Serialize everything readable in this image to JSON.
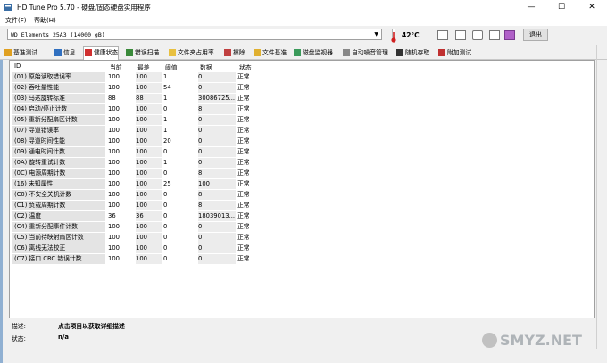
{
  "window": {
    "title": "HD Tune Pro 5.70 - 硬盘/固态硬盘实用程序",
    "minimize": "—",
    "maximize": "☐",
    "close": "✕"
  },
  "menu": [
    "文件(F)",
    "帮助(H)"
  ],
  "drive": {
    "selected": "WD      Elements 25A3 (14000 gB)",
    "temperature": "42°C",
    "exit_label": "退出"
  },
  "toolbar_icons": [
    "copy-icon",
    "copy-all-icon",
    "screenshot-icon",
    "options-icon",
    "save-icon"
  ],
  "tabs": [
    {
      "label": "基准测试",
      "icon": "benchmark-icon"
    },
    {
      "label": "信息",
      "icon": "info-icon"
    },
    {
      "label": "健康状态",
      "icon": "health-icon",
      "active": true
    },
    {
      "label": "错误扫描",
      "icon": "error-scan-icon"
    },
    {
      "label": "文件夹占用率",
      "icon": "folder-usage-icon"
    },
    {
      "label": "擦除",
      "icon": "erase-icon"
    },
    {
      "label": "文件基准",
      "icon": "file-benchmark-icon"
    },
    {
      "label": "磁盘监视器",
      "icon": "disk-monitor-icon"
    },
    {
      "label": "自动噪音管理",
      "icon": "aam-icon"
    },
    {
      "label": "随机存取",
      "icon": "random-access-icon"
    },
    {
      "label": "附加测试",
      "icon": "extra-tests-icon"
    }
  ],
  "table": {
    "headers": [
      "ID",
      "当前",
      "最差",
      "阈值",
      "数据",
      "状态"
    ],
    "rows": [
      [
        "(01) 原始读取错误率",
        "100",
        "100",
        "1",
        "0",
        "正常"
      ],
      [
        "(02) 吞吐量性能",
        "100",
        "100",
        "54",
        "0",
        "正常"
      ],
      [
        "(03) 马达旋转标准",
        "88",
        "88",
        "1",
        "30086725...",
        "正常"
      ],
      [
        "(04) 启动/停止计数",
        "100",
        "100",
        "0",
        "8",
        "正常"
      ],
      [
        "(05) 重新分配扇区计数",
        "100",
        "100",
        "1",
        "0",
        "正常"
      ],
      [
        "(07) 寻道错误率",
        "100",
        "100",
        "1",
        "0",
        "正常"
      ],
      [
        "(08) 寻道时间性能",
        "100",
        "100",
        "20",
        "0",
        "正常"
      ],
      [
        "(09) 通电时间计数",
        "100",
        "100",
        "0",
        "0",
        "正常"
      ],
      [
        "(0A) 旋转重试计数",
        "100",
        "100",
        "1",
        "0",
        "正常"
      ],
      [
        "(0C) 电源周期计数",
        "100",
        "100",
        "0",
        "8",
        "正常"
      ],
      [
        "(16) 未知属性",
        "100",
        "100",
        "25",
        "100",
        "正常"
      ],
      [
        "(C0) 不安全关机计数",
        "100",
        "100",
        "0",
        "8",
        "正常"
      ],
      [
        "(C1) 负载周期计数",
        "100",
        "100",
        "0",
        "8",
        "正常"
      ],
      [
        "(C2) 温度",
        "36",
        "36",
        "0",
        "18039013...",
        "正常"
      ],
      [
        "(C4) 重新分配事件计数",
        "100",
        "100",
        "0",
        "0",
        "正常"
      ],
      [
        "(C5) 当前待映射扇区计数",
        "100",
        "100",
        "0",
        "0",
        "正常"
      ],
      [
        "(C6) 离线无法校正",
        "100",
        "100",
        "0",
        "0",
        "正常"
      ],
      [
        "(C7) 接口 CRC 错误计数",
        "100",
        "100",
        "0",
        "0",
        "正常"
      ]
    ]
  },
  "description": {
    "label": "描述:",
    "value": "点击项目以获取详细描述",
    "status_label": "状态:",
    "status_value": "n/a"
  },
  "watermark": "SMYZ.NET"
}
